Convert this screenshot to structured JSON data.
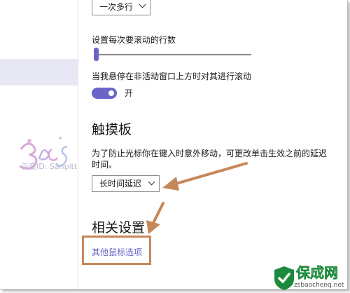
{
  "scroll_mode": {
    "selected": "一次多行"
  },
  "scroll_lines": {
    "label": "设置每次要滚动的行数",
    "value": 1
  },
  "inactive_scroll": {
    "label": "当我悬停在非活动窗口上方时对其进行滚动",
    "state": "开",
    "on": true
  },
  "touchpad": {
    "title": "触摸板",
    "description_line1": "为了防止光标你在键入时意外移动，可更改单击生效之前的延迟",
    "description_line2": "时间。",
    "delay_selected": "长时间延迟"
  },
  "related": {
    "title": "相关设置",
    "link": "其他鼠标选项"
  },
  "watermark": {
    "text": "百度ID: Sanpitt"
  },
  "site_brand": {
    "name": "保成网",
    "url": "zsbaochenq.net"
  },
  "colors": {
    "accent": "#6b64c9",
    "annotation": "#c7875a",
    "link": "#6a62c6"
  }
}
